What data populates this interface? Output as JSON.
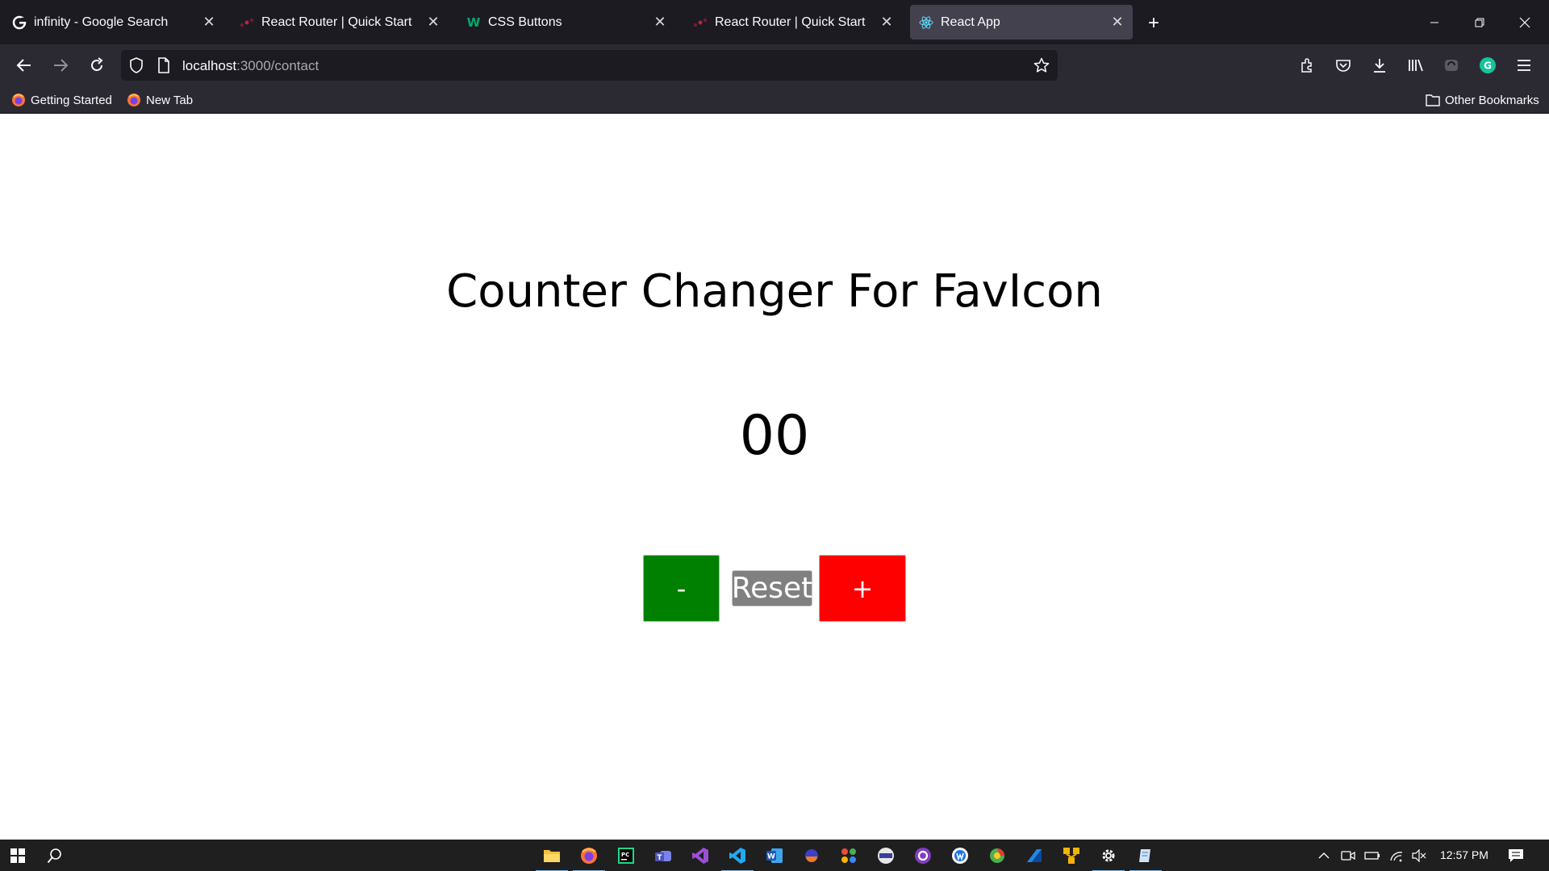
{
  "browser": {
    "tabs": [
      {
        "title": "infinity - Google Search",
        "icon": "google-icon"
      },
      {
        "title": "React Router | Quick Start",
        "icon": "react-router-icon"
      },
      {
        "title": "CSS Buttons",
        "icon": "w3schools-icon"
      },
      {
        "title": "React Router | Quick Start",
        "icon": "react-router-icon"
      },
      {
        "title": "React App",
        "icon": "react-icon",
        "active": true
      }
    ],
    "url": {
      "host": "localhost",
      "path": ":3000/contact"
    },
    "bookmarks": [
      {
        "label": "Getting Started",
        "icon": "firefox-icon"
      },
      {
        "label": "New Tab",
        "icon": "firefox-icon"
      }
    ],
    "other_bookmarks": "Other Bookmarks"
  },
  "page": {
    "title": "Counter Changer For FavIcon",
    "counter": "00",
    "buttons": {
      "minus": "-",
      "reset": "Reset",
      "plus": "+"
    },
    "colors": {
      "minus": "#008000",
      "reset": "#808080",
      "plus": "#ff0000"
    }
  },
  "taskbar": {
    "apps": [
      "file-explorer-icon",
      "firefox-icon",
      "pycharm-icon",
      "teams-icon",
      "visual-studio-icon",
      "vscode-icon",
      "word-icon",
      "app-icon",
      "app-icon",
      "app-icon",
      "github-icon",
      "app-icon",
      "app-icon",
      "app-icon",
      "app-icon",
      "settings-icon",
      "app-icon"
    ],
    "clock": "12:57 PM"
  }
}
